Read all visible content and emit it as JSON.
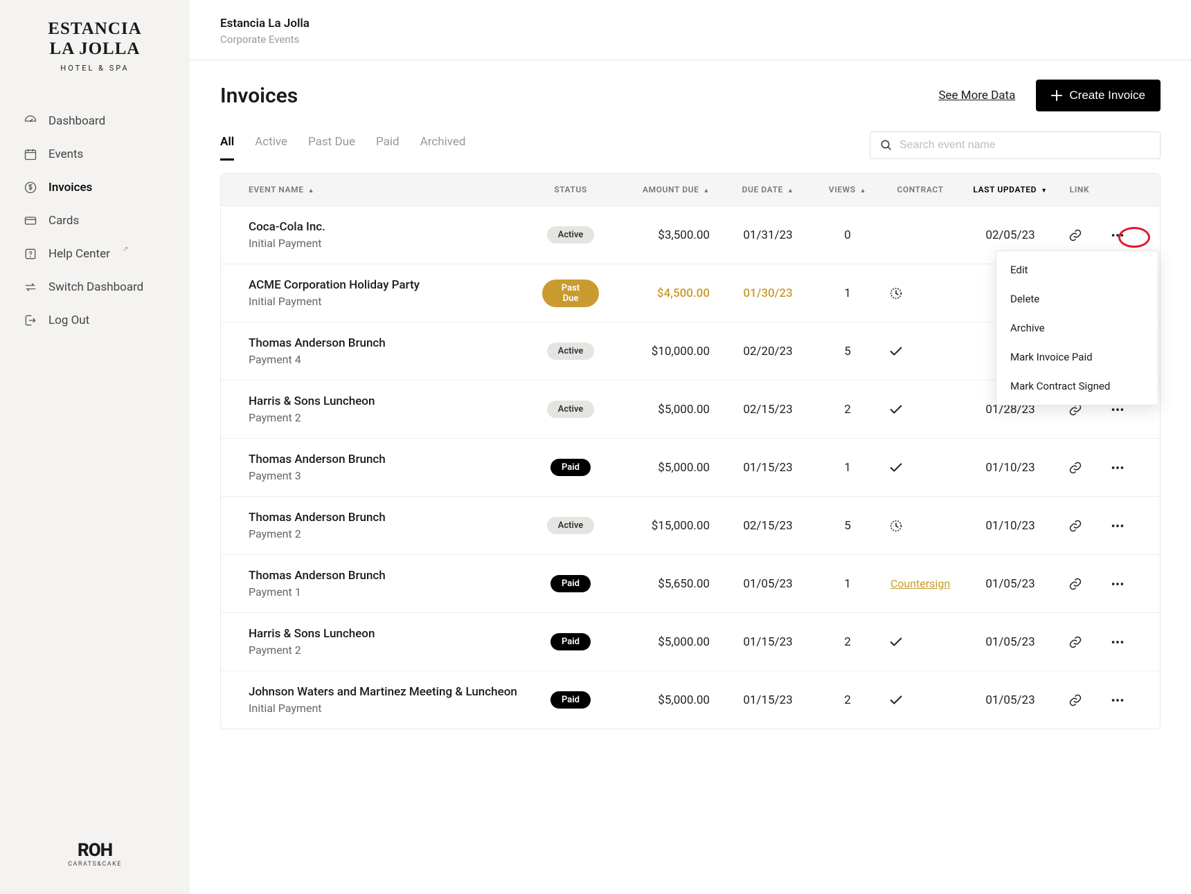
{
  "brand": {
    "line1": "ESTANCIA",
    "line2": "LA JOLLA",
    "sub": "HOTEL & SPA"
  },
  "footer_brand": {
    "main": "ROH",
    "sub": "CARATS&CAKE"
  },
  "nav": [
    {
      "label": "Dashboard",
      "icon": "gauge"
    },
    {
      "label": "Events",
      "icon": "calendar"
    },
    {
      "label": "Invoices",
      "icon": "dollar",
      "active": true
    },
    {
      "label": "Cards",
      "icon": "card"
    },
    {
      "label": "Help Center",
      "icon": "help",
      "external": true
    },
    {
      "label": "Switch Dashboard",
      "icon": "swap"
    },
    {
      "label": "Log Out",
      "icon": "logout"
    }
  ],
  "breadcrumb": {
    "title": "Estancia La Jolla",
    "sub": "Corporate Events"
  },
  "page": {
    "title": "Invoices",
    "see_more": "See More Data",
    "create": "Create Invoice"
  },
  "tabs": [
    "All",
    "Active",
    "Past Due",
    "Paid",
    "Archived"
  ],
  "active_tab": "All",
  "search": {
    "placeholder": "Search event name"
  },
  "columns": {
    "event": "Event Name",
    "status": "Status",
    "amount": "Amount Due",
    "due": "Due Date",
    "views": "Views",
    "contract": "Contract",
    "updated": "Last Updated",
    "link": "Link"
  },
  "sort": {
    "column": "updated",
    "dir": "desc"
  },
  "rows": [
    {
      "event": "Coca-Cola Inc.",
      "payment": "Initial Payment",
      "status": "Active",
      "amount": "$3,500.00",
      "due": "01/31/23",
      "views": "0",
      "contract": "",
      "updated": "02/05/23",
      "menu_open": true,
      "highlight": true
    },
    {
      "event": "ACME Corporation Holiday Party",
      "payment": "Initial Payment",
      "status": "Past Due",
      "amount": "$4,500.00",
      "due": "01/30/23",
      "views": "1",
      "contract": "clock",
      "updated": "",
      "amber": true
    },
    {
      "event": "Thomas Anderson Brunch",
      "payment": "Payment 4",
      "status": "Active",
      "amount": "$10,000.00",
      "due": "02/20/23",
      "views": "5",
      "contract": "check",
      "updated": ""
    },
    {
      "event": "Harris & Sons Luncheon",
      "payment": "Payment 2",
      "status": "Active",
      "amount": "$5,000.00",
      "due": "02/15/23",
      "views": "2",
      "contract": "check",
      "updated": "01/28/23"
    },
    {
      "event": "Thomas Anderson Brunch",
      "payment": "Payment 3",
      "status": "Paid",
      "amount": "$5,000.00",
      "due": "01/15/23",
      "views": "1",
      "contract": "check",
      "updated": "01/10/23"
    },
    {
      "event": "Thomas Anderson Brunch",
      "payment": "Payment 2",
      "status": "Active",
      "amount": "$15,000.00",
      "due": "02/15/23",
      "views": "5",
      "contract": "clock",
      "updated": "01/10/23"
    },
    {
      "event": "Thomas Anderson Brunch",
      "payment": "Payment 1",
      "status": "Paid",
      "amount": "$5,650.00",
      "due": "01/05/23",
      "views": "1",
      "contract": "countersign",
      "updated": "01/05/23"
    },
    {
      "event": "Harris & Sons Luncheon",
      "payment": "Payment 2",
      "status": "Paid",
      "amount": "$5,000.00",
      "due": "01/15/23",
      "views": "2",
      "contract": "check",
      "updated": "01/05/23"
    },
    {
      "event": "Johnson Waters and Martinez Meeting & Luncheon",
      "payment": "Initial Payment",
      "status": "Paid",
      "amount": "$5,000.00",
      "due": "01/15/23",
      "views": "2",
      "contract": "check",
      "updated": "01/05/23"
    }
  ],
  "row_menu": [
    "Edit",
    "Delete",
    "Archive",
    "Mark Invoice Paid",
    "Mark Contract Signed"
  ],
  "countersign_label": "Countersign"
}
